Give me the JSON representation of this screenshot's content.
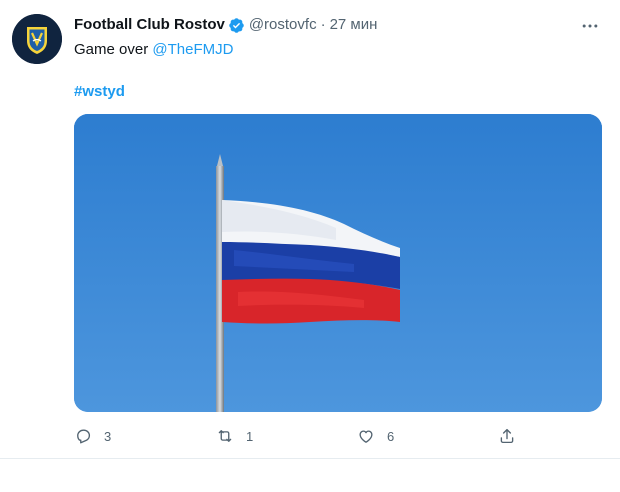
{
  "tweet": {
    "display_name": "Football Club Rostov",
    "handle": "@rostovfc",
    "separator": "·",
    "time": "27 мин",
    "text_prefix": "Game over ",
    "mention": "@TheFMJD",
    "hashtag": "#wstyd",
    "media_description_icon": "russian-flag-image",
    "avatar_icon": "fc-rostov-crest-icon",
    "verified_icon": "verified-badge-icon",
    "colors": {
      "accent": "#1d9bf0",
      "text": "#0f1419",
      "secondary": "#536471"
    }
  },
  "actions": {
    "reply_icon": "reply-icon",
    "reply_count": "3",
    "retweet_icon": "retweet-icon",
    "retweet_count": "1",
    "like_icon": "heart-icon",
    "like_count": "6",
    "share_icon": "share-icon"
  }
}
